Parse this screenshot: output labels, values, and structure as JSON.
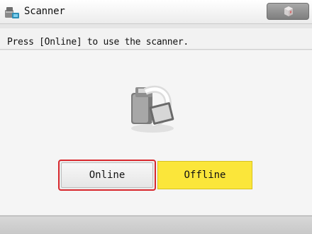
{
  "titlebar": {
    "title": "Scanner",
    "app_icon": "scanner-app-icon",
    "status_icon": "device-status-icon"
  },
  "message": {
    "text": "Press [Online] to use the scanner."
  },
  "illustration": {
    "icon": "scanner-device-icon"
  },
  "buttons": {
    "online_label": "Online",
    "offline_label": "Offline"
  },
  "colors": {
    "selected_border": "#d8282d",
    "offline_background": "#fbe63a"
  }
}
